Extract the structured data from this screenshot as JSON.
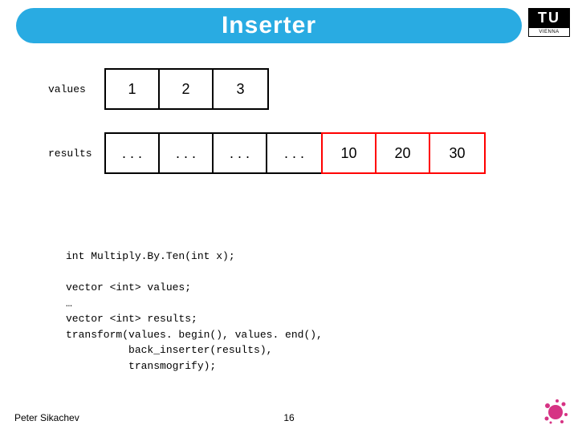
{
  "title": "Inserter",
  "logo": {
    "top": "TU",
    "bottom": "VIENNA"
  },
  "values_label": "values",
  "results_label": "results",
  "values": [
    "1",
    "2",
    "3"
  ],
  "results_old": [
    ". . .",
    ". . .",
    ". . .",
    ". . ."
  ],
  "results_new": [
    "10",
    "20",
    "30"
  ],
  "code_lines": [
    "int Multiply.By.Ten(int x);",
    "",
    "vector <int> values;",
    "…",
    "vector <int> results;",
    "transform(values. begin(), values. end(),",
    "          back_inserter(results),",
    "          transmogrify);"
  ],
  "footer": {
    "author": "Peter Sikachev",
    "page": "16"
  }
}
